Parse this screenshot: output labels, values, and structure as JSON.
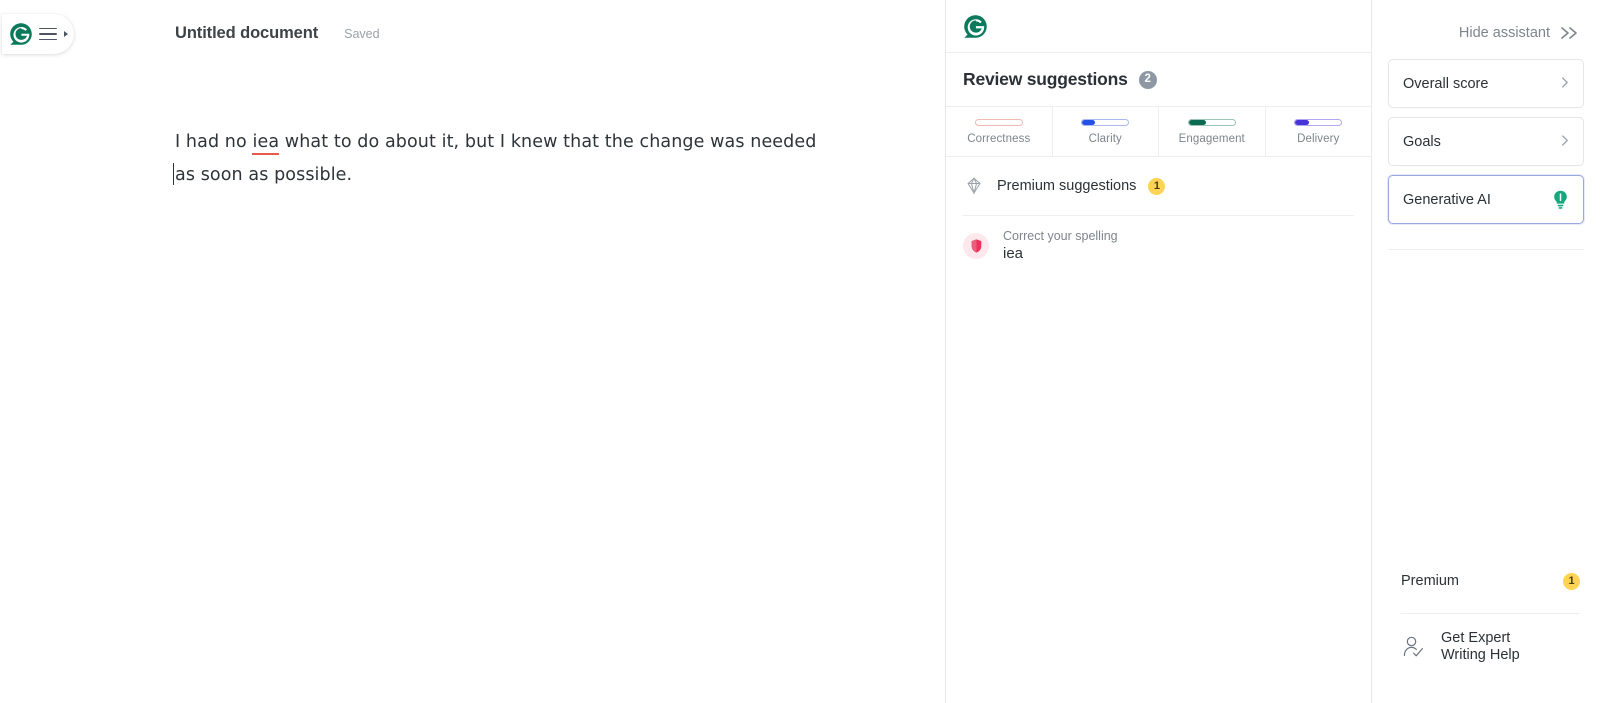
{
  "editor": {
    "logo_pill": {
      "brand": "grammarly-logo",
      "menu": "hamburger-menu"
    },
    "document_title": "Untitled document",
    "save_status": "Saved",
    "text": {
      "line1_before": "I had no ",
      "line1_misspelled": "iea",
      "line1_after": " what to do about it, but I knew that the change was needed",
      "line2": "as soon as possible."
    }
  },
  "suggestions_panel": {
    "brand_icon": "grammarly-logo-icon",
    "title": "Review suggestions",
    "count": "2",
    "categories": [
      {
        "label": "Correctness",
        "fill_pct": 0,
        "color": "#e8594e",
        "track": "#f3b9b4"
      },
      {
        "label": "Clarity",
        "fill_pct": 28,
        "color": "#2350e8",
        "track": "#aab9ee"
      },
      {
        "label": "Engagement",
        "fill_pct": 38,
        "color": "#0a6b52",
        "track": "#9dc3b7"
      },
      {
        "label": "Delivery",
        "fill_pct": 30,
        "color": "#4733d6",
        "track": "#b0a8ee"
      }
    ],
    "premium_row": {
      "icon": "gem-icon",
      "label": "Premium suggestions",
      "badge": "1"
    },
    "cards": [
      {
        "icon": "spelling-shield-icon",
        "kicker": "Correct your spelling",
        "word": "iea"
      }
    ]
  },
  "assistant": {
    "hide_label": "Hide assistant",
    "hide_icon": "double-chevron-right-icon",
    "cards": [
      {
        "label": "Overall score",
        "trailing": "chevron-right-icon",
        "active": false
      },
      {
        "label": "Goals",
        "trailing": "chevron-right-icon",
        "active": false
      },
      {
        "label": "Generative AI",
        "trailing": "lightbulb-icon",
        "active": true
      }
    ],
    "premium_footer": {
      "label": "Premium",
      "badge": "1"
    },
    "expert_help": {
      "icon": "person-check-icon",
      "label": "Get Expert Writing Help"
    }
  },
  "colors": {
    "brand_green": "#15a77e",
    "brand_green_dark": "#0b7a5c",
    "amber": "#ffd454",
    "spell_red": "#e8335b",
    "accent_border": "#9aa8e0"
  }
}
